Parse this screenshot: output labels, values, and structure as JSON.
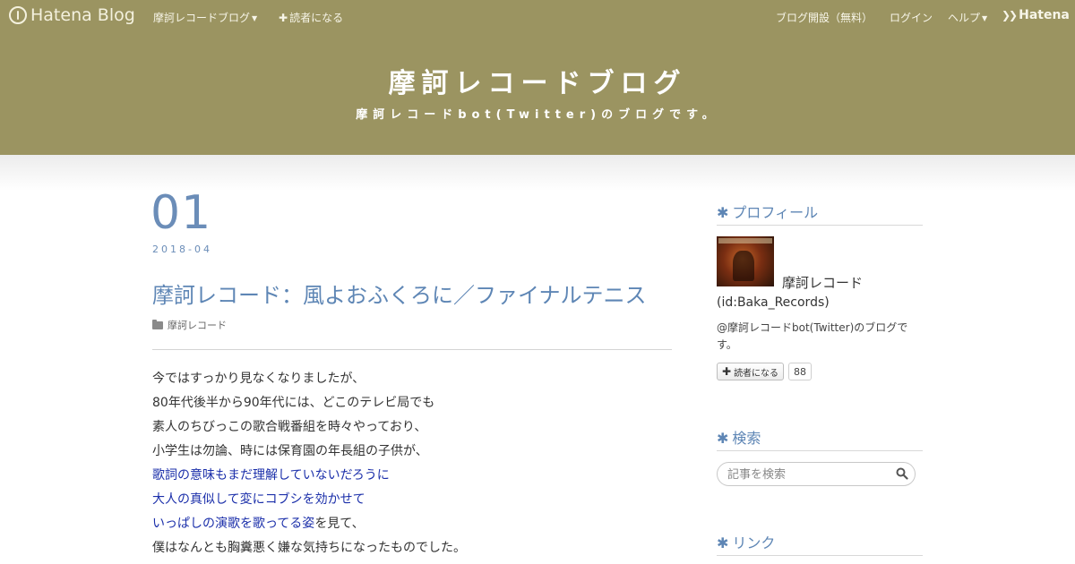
{
  "topbar": {
    "logo_text": "Hatena Blog",
    "blog_menu": "摩訶レコードブログ",
    "subscribe": "読者になる",
    "open_blog": "ブログ開設（無料）",
    "login": "ログイン",
    "help": "ヘルプ",
    "hatena_text": "Hatena"
  },
  "blog": {
    "title": "摩訶レコードブログ",
    "description": "摩訶レコードbot(Twitter)のブログです。"
  },
  "entry": {
    "day": "01",
    "year_month": "2018-04",
    "title": "摩訶レコード：風よおふくろに／ファイナルテニス",
    "category": "摩訶レコード",
    "body": [
      {
        "text": "今ではすっかり見なくなりましたが、",
        "emph": false
      },
      {
        "text": "80年代後半から90年代には、どこのテレビ局でも",
        "emph": false
      },
      {
        "text": "素人のちびっこの歌合戦番組を時々やっており、",
        "emph": false
      },
      {
        "text": "小学生は勿論、時には保育園の年長組の子供が、",
        "emph": false
      },
      {
        "text": "歌詞の意味もまだ理解していないだろうに",
        "emph": true
      },
      {
        "text": "大人の真似して変にコブシを効かせて",
        "emph": true
      },
      {
        "text": "いっぱしの演歌を歌ってる姿",
        "emph": true,
        "tail": "を見て、"
      },
      {
        "text": "僕はなんとも胸糞悪く嫌な気持ちになったものでした。",
        "emph": false
      }
    ]
  },
  "sidebar": {
    "profile_heading": "プロフィール",
    "profile_name": "摩訶レコード",
    "profile_id": "(id:Baka_Records)",
    "profile_desc": "@摩訶レコードbot(Twitter)のブログです。",
    "subscribe_label": "読者になる",
    "subscriber_count": "88",
    "search_heading": "検索",
    "search_placeholder": "記事を検索",
    "links_heading": "リンク"
  },
  "colors": {
    "header_bg": "#9b9461",
    "accent_blue": "#5e86b5",
    "emphasis_text": "#1b2faa"
  }
}
